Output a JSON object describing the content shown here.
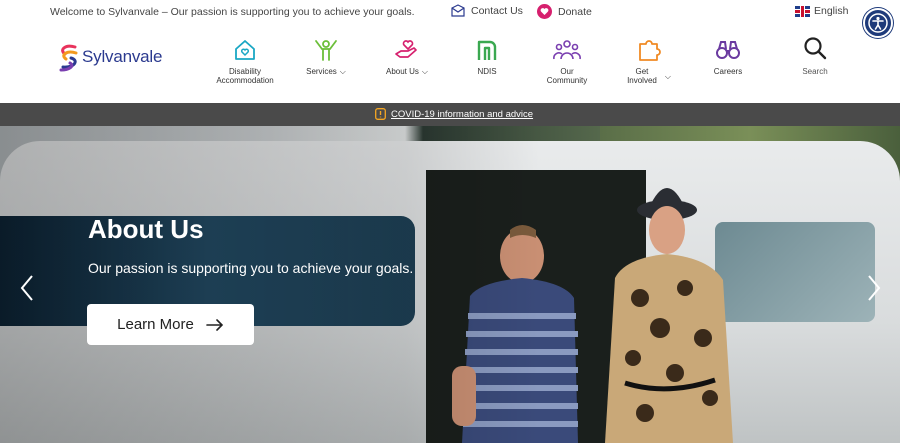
{
  "topbar": {
    "welcome": "Welcome to Sylvanvale – Our passion is supporting you to achieve your goals.",
    "contact": "Contact Us",
    "donate": "Donate",
    "language": "English"
  },
  "brand": {
    "name": "Sylvanvale"
  },
  "nav": {
    "disability_line1": "Disability",
    "disability_line2": "Accommodation",
    "services": "Services",
    "about": "About Us",
    "ndis": "NDIS",
    "community_line1": "Our",
    "community_line2": "Community",
    "involved_line1": "Get",
    "involved_line2": "Involved",
    "careers": "Careers",
    "search": "Search"
  },
  "alert": {
    "text": "COVID-19 information and advice",
    "icon": "!"
  },
  "hero": {
    "title": "About Us",
    "subtitle": "Our passion is supporting you to achieve your goals.",
    "button": "Learn More"
  },
  "colors": {
    "brand_blue": "#2b3a8f",
    "disability": "#1aa7c4",
    "services": "#6cbf3a",
    "about": "#d6206e",
    "ndis": "#3aa850",
    "community": "#7a3fb0",
    "involved": "#f08a24",
    "careers": "#6a3aa0",
    "alert_bar": "#4a4a4a"
  }
}
